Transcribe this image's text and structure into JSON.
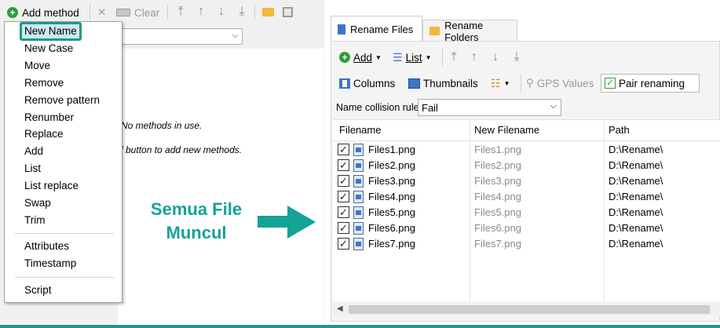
{
  "left_toolbar": {
    "add_method_label": "Add method",
    "clear_label": "Clear"
  },
  "method_menu": {
    "items": [
      "New Name",
      "New Case",
      "Move",
      "Remove",
      "Remove pattern",
      "Renumber",
      "Replace",
      "Add",
      "List",
      "List replace",
      "Swap",
      "Trim"
    ],
    "items2": [
      "Attributes",
      "Timestamp"
    ],
    "items3": [
      "Script"
    ]
  },
  "left_panel": {
    "hint_line1": "No methods in use.",
    "hint_line2": "d button to add new methods."
  },
  "annotation": {
    "line1": "Semua File",
    "line2": "Muncul"
  },
  "tabs": [
    {
      "label": "Rename Files",
      "active": true
    },
    {
      "label": "Rename Folders",
      "active": false
    }
  ],
  "right_toolbar": {
    "add_label": "Add",
    "list_label": "List",
    "columns_label": "Columns",
    "thumbnails_label": "Thumbnails",
    "gps_label": "GPS Values",
    "pair_label": "Pair renaming"
  },
  "collision": {
    "label": "Name collision rule:",
    "value": "Fail"
  },
  "grid": {
    "headers": [
      "Filename",
      "New Filename",
      "Path"
    ],
    "rows": [
      {
        "filename": "Files1.png",
        "new": "Files1.png",
        "path": "D:\\Rename\\"
      },
      {
        "filename": "Files2.png",
        "new": "Files2.png",
        "path": "D:\\Rename\\"
      },
      {
        "filename": "Files3.png",
        "new": "Files3.png",
        "path": "D:\\Rename\\"
      },
      {
        "filename": "Files4.png",
        "new": "Files4.png",
        "path": "D:\\Rename\\"
      },
      {
        "filename": "Files5.png",
        "new": "Files5.png",
        "path": "D:\\Rename\\"
      },
      {
        "filename": "Files6.png",
        "new": "Files6.png",
        "path": "D:\\Rename\\"
      },
      {
        "filename": "Files7.png",
        "new": "Files7.png",
        "path": "D:\\Rename\\"
      }
    ]
  },
  "colors": {
    "accent": "#1b9b8a",
    "annotation": "#14a394",
    "add_green": "#2e9e3e"
  }
}
